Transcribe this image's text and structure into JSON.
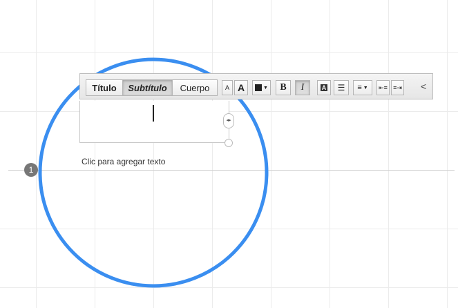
{
  "toolbar": {
    "style_titulo": "Título",
    "style_subtitulo": "Subtítulo",
    "style_cuerpo": "Cuerpo",
    "font_small_label": "A",
    "font_large_label": "A",
    "bold_label": "B",
    "italic_label": "I",
    "highlight_label": "A",
    "collapse_glyph": "<",
    "icons": [
      "color-swatch-icon",
      "list-icon",
      "align-icon",
      "outdent-icon",
      "indent-icon"
    ],
    "selected_style": "Subtítulo"
  },
  "canvas": {
    "placeholder_text": "Clic para agregar texto",
    "marker_number": "1",
    "shape_color": "#3a8ef0"
  }
}
